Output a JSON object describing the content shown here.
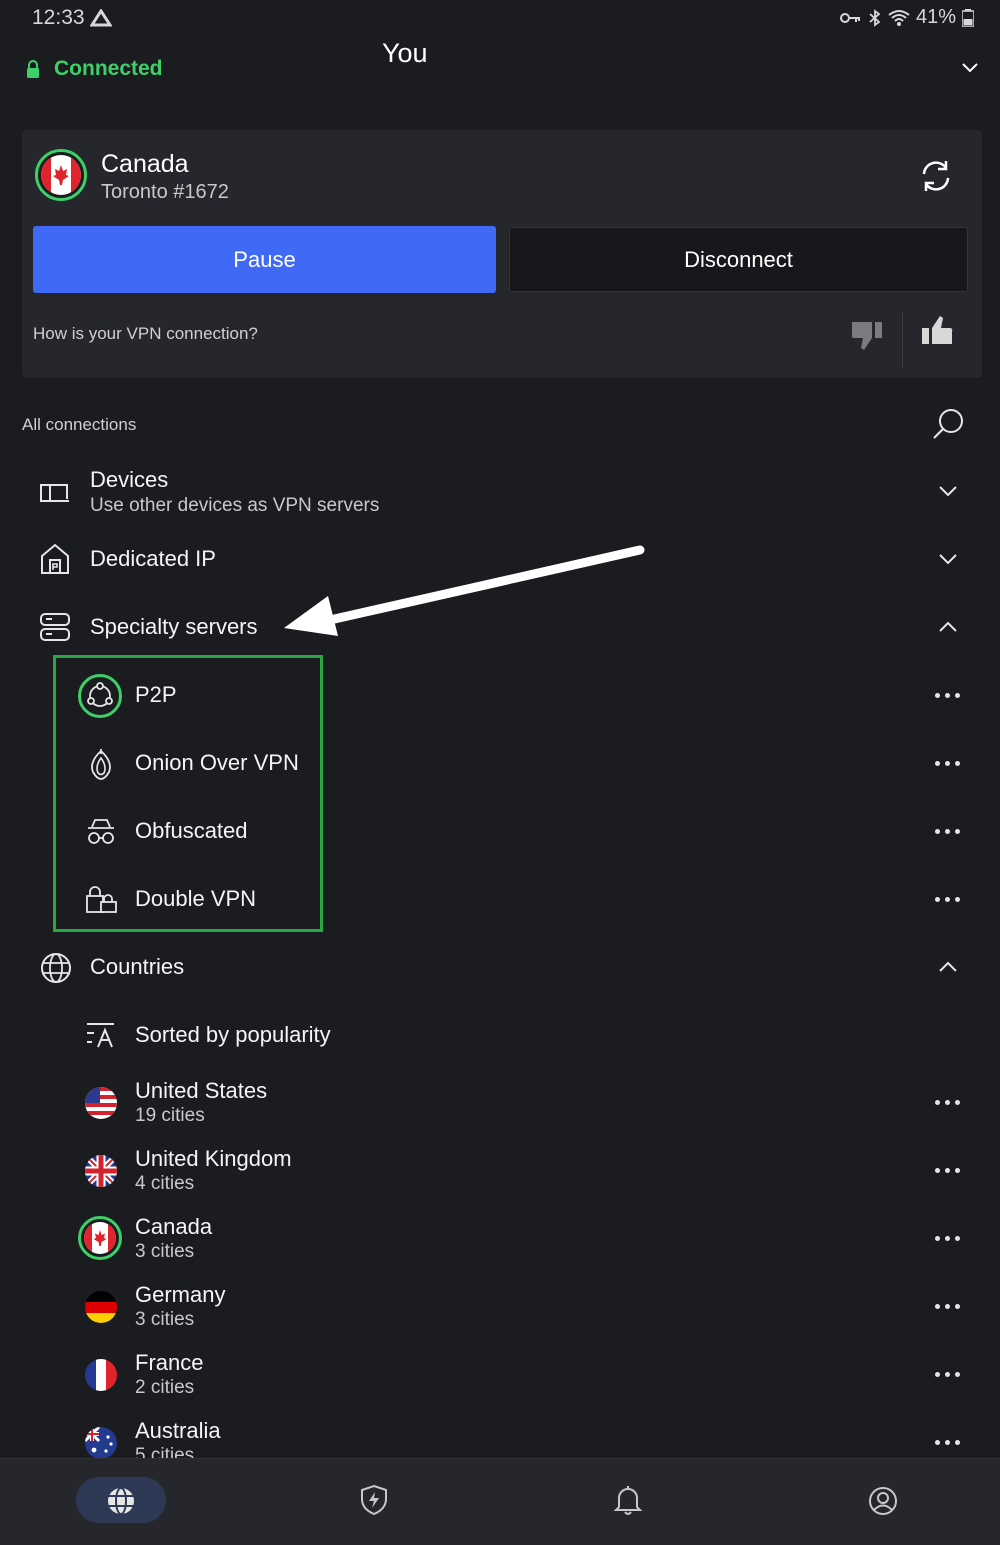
{
  "status_bar": {
    "time": "12:33",
    "battery": "41%"
  },
  "header": {
    "status": "Connected",
    "title": "You"
  },
  "connection": {
    "country": "Canada",
    "server": "Toronto #1672",
    "pause_label": "Pause",
    "disconnect_label": "Disconnect",
    "feedback_question": "How is your VPN connection?"
  },
  "section_label": "All connections",
  "groups": {
    "devices": {
      "title": "Devices",
      "subtitle": "Use other devices as VPN servers"
    },
    "dedicated_ip": {
      "title": "Dedicated IP"
    },
    "specialty": {
      "title": "Specialty servers"
    },
    "countries": {
      "title": "Countries"
    }
  },
  "specialty_items": [
    {
      "label": "P2P",
      "icon": "p2p-icon"
    },
    {
      "label": "Onion Over VPN",
      "icon": "onion-icon"
    },
    {
      "label": "Obfuscated",
      "icon": "obfuscated-icon"
    },
    {
      "label": "Double VPN",
      "icon": "double-vpn-icon"
    }
  ],
  "sort_label": "Sorted by popularity",
  "countries": [
    {
      "name": "United States",
      "cities": "19 cities"
    },
    {
      "name": "United Kingdom",
      "cities": "4 cities"
    },
    {
      "name": "Canada",
      "cities": "3 cities"
    },
    {
      "name": "Germany",
      "cities": "3 cities"
    },
    {
      "name": "France",
      "cities": "2 cities"
    },
    {
      "name": "Australia",
      "cities": "5 cities"
    }
  ],
  "bottom_nav": [
    "globe-icon",
    "shield-bolt-icon",
    "bell-icon",
    "profile-icon"
  ],
  "colors": {
    "accent": "#4069f5",
    "connected": "#3dd068",
    "highlight": "#27a844",
    "background": "#1b1c1f",
    "card": "#25272c"
  }
}
